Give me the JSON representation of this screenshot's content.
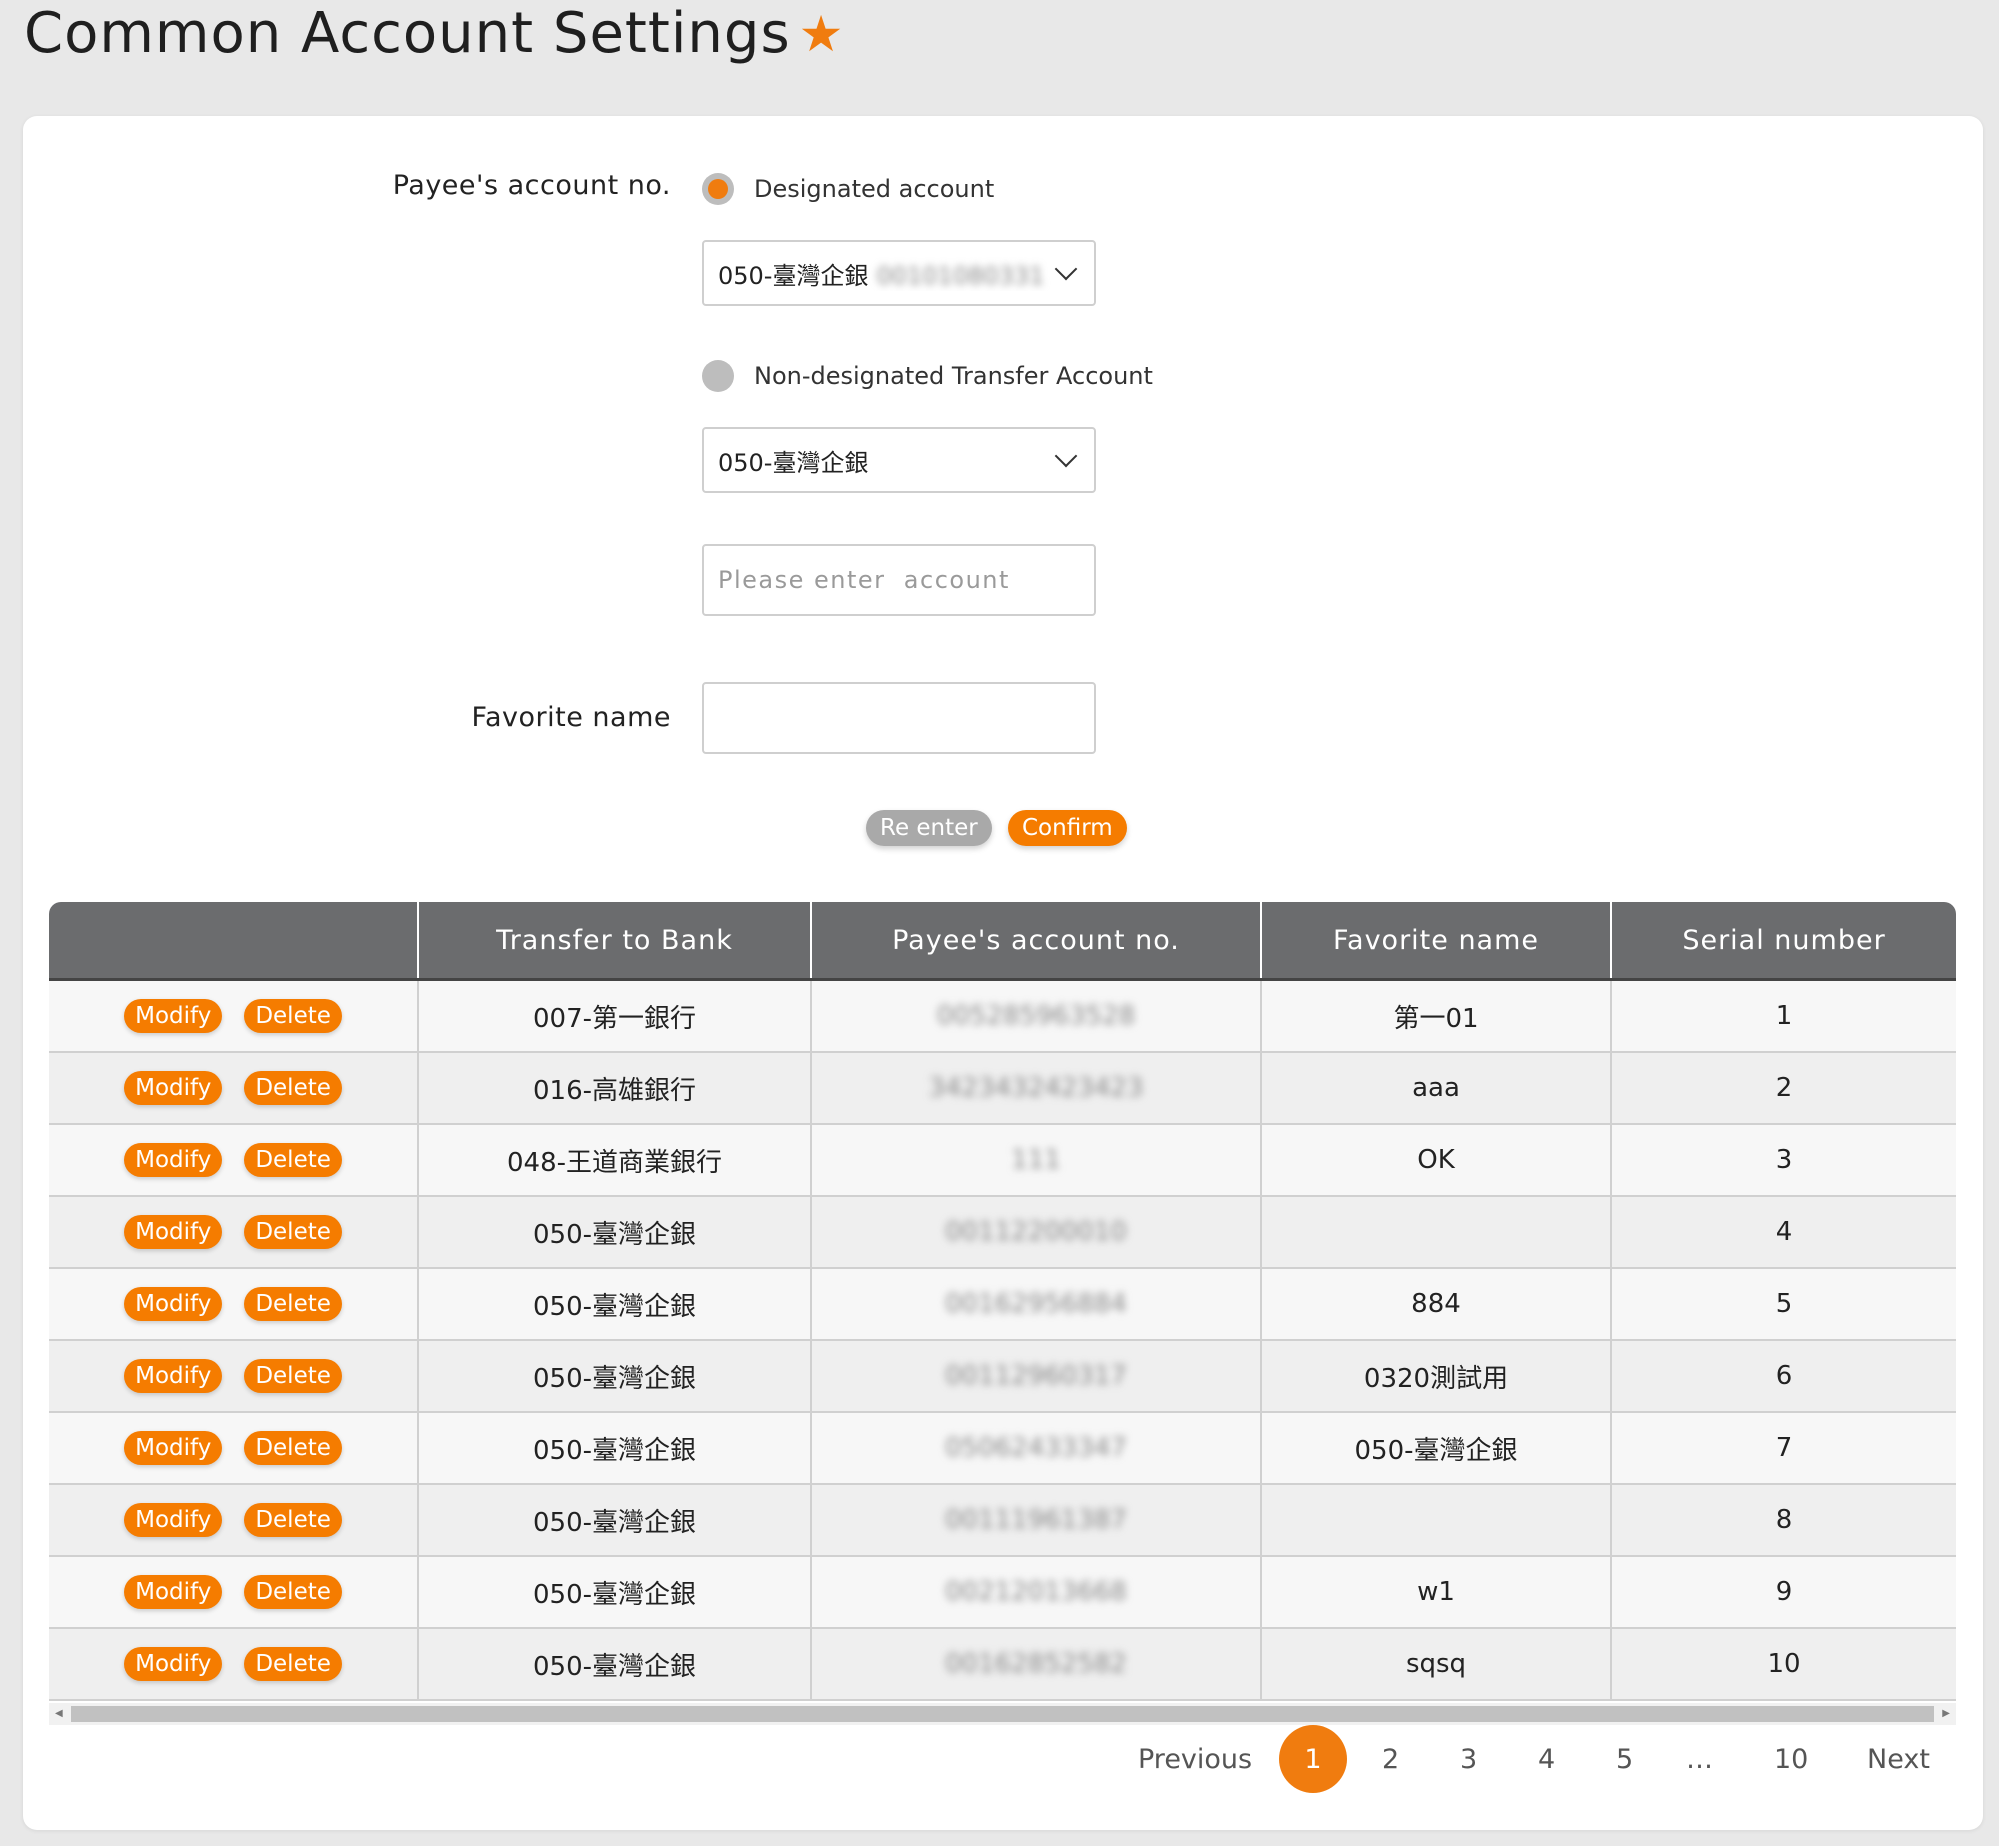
{
  "page": {
    "title": "Common Account Settings"
  },
  "form": {
    "payee_label": "Payee's account no.",
    "designated_label": "Designated account",
    "designated_select": {
      "bank": "050-臺灣企銀",
      "account": "00101080331"
    },
    "nondesignated_label": "Non-designated Transfer Account",
    "nondesignated_select": "050-臺灣企銀",
    "account_placeholder": "Please enter  account",
    "favorite_label": "Favorite name",
    "favorite_value": "",
    "reenter_label": "Re enter",
    "confirm_label": "Confirm"
  },
  "table": {
    "headers": [
      "",
      "Transfer to Bank",
      "Payee's account no.",
      "Favorite name",
      "Serial number"
    ],
    "modify_label": "Modify",
    "delete_label": "Delete",
    "rows": [
      {
        "bank": "007-第一銀行",
        "account": "005285963528",
        "favorite": "第一01",
        "serial": "1"
      },
      {
        "bank": "016-高雄銀行",
        "account": "3423432423423",
        "favorite": "aaa",
        "serial": "2"
      },
      {
        "bank": "048-王道商業銀行",
        "account": "111",
        "favorite": "OK",
        "serial": "3"
      },
      {
        "bank": "050-臺灣企銀",
        "account": "00112200010",
        "favorite": "",
        "serial": "4"
      },
      {
        "bank": "050-臺灣企銀",
        "account": "00162956884",
        "favorite": "884",
        "serial": "5"
      },
      {
        "bank": "050-臺灣企銀",
        "account": "00112960317",
        "favorite": "0320測試用",
        "serial": "6"
      },
      {
        "bank": "050-臺灣企銀",
        "account": "05062433347",
        "favorite": "050-臺灣企銀",
        "serial": "7"
      },
      {
        "bank": "050-臺灣企銀",
        "account": "00111961387",
        "favorite": "",
        "serial": "8"
      },
      {
        "bank": "050-臺灣企銀",
        "account": "00212013668",
        "favorite": "w1",
        "serial": "9"
      },
      {
        "bank": "050-臺灣企銀",
        "account": "00162852582",
        "favorite": "sqsq",
        "serial": "10"
      }
    ]
  },
  "pagination": {
    "previous": "Previous",
    "pages": [
      "1",
      "2",
      "3",
      "4",
      "5"
    ],
    "ellipsis": "…",
    "last": "10",
    "next": "Next"
  },
  "colors": {
    "accent": "#f07c0f",
    "header_bg": "#6b6c6e",
    "secondary_button": "#a9a9a9"
  },
  "icons": [
    "star-icon",
    "chevron-down-icon"
  ]
}
